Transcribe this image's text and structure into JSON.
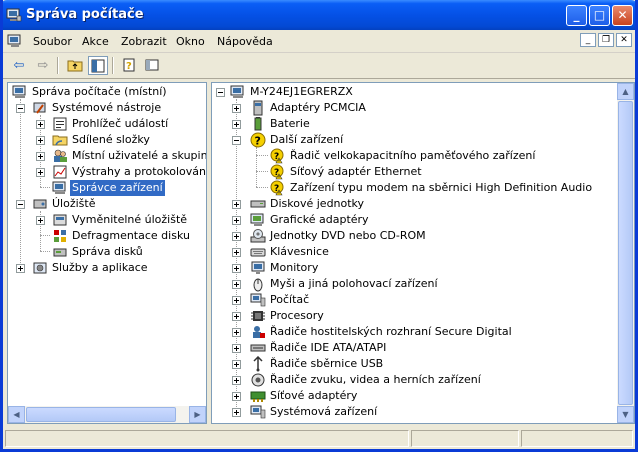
{
  "window": {
    "title": "Správa počítače",
    "buttons": {
      "minimize": "_",
      "maximize": "□",
      "close": "✕"
    },
    "colors": {
      "titlebar": "#0551e6",
      "selection": "#316ac5"
    }
  },
  "menu": {
    "items": [
      "Soubor",
      "Akce",
      "Zobrazit",
      "Okno",
      "Nápověda"
    ],
    "mdi_buttons": [
      "_",
      "❐",
      "✕"
    ]
  },
  "toolbar": {
    "buttons": [
      "back-arrow-icon",
      "forward-arrow-icon",
      "up-folder-icon",
      "show-hide-tree-icon",
      "properties-icon",
      "help-icon"
    ]
  },
  "left_tree": {
    "root": "Správa počítače (místní)",
    "groups": [
      {
        "label": "Systémové nástroje",
        "children": [
          "Prohlížeč událostí",
          "Sdílené složky",
          "Místní uživatelé a skupiny",
          "Výstrahy a protokolování vý",
          "Správce zařízení"
        ],
        "selected": "Správce zařízení"
      },
      {
        "label": "Úložiště",
        "children": [
          "Vyměnitelné úložiště",
          "Defragmentace disku",
          "Správa disků"
        ]
      },
      {
        "label": "Služby a aplikace",
        "children": []
      }
    ]
  },
  "right_tree": {
    "root": "M-Y24EJ1EGRERZX",
    "categories": [
      "Adaptéry PCMCIA",
      "Baterie",
      "Další zařízení",
      "Diskové jednotky",
      "Grafické adaptéry",
      "Jednotky DVD nebo CD-ROM",
      "Klávesnice",
      "Monitory",
      "Myši a jiná polohovací zařízení",
      "Počítač",
      "Procesory",
      "Řadiče hostitelských rozhraní Secure Digital",
      "Řadiče IDE ATA/ATAPI",
      "Řadiče sběrnice USB",
      "Řadiče zvuku, videa a herních zařízení",
      "Síťové adaptéry",
      "Systémová zařízení"
    ],
    "expanded": "Další zařízení",
    "other_devices": [
      "Řadič velkokapacitního paměťového zařízení",
      "Síťový adaptér Ethernet",
      "Zařízení typu modem na sběrnici High Definition Audio"
    ]
  }
}
